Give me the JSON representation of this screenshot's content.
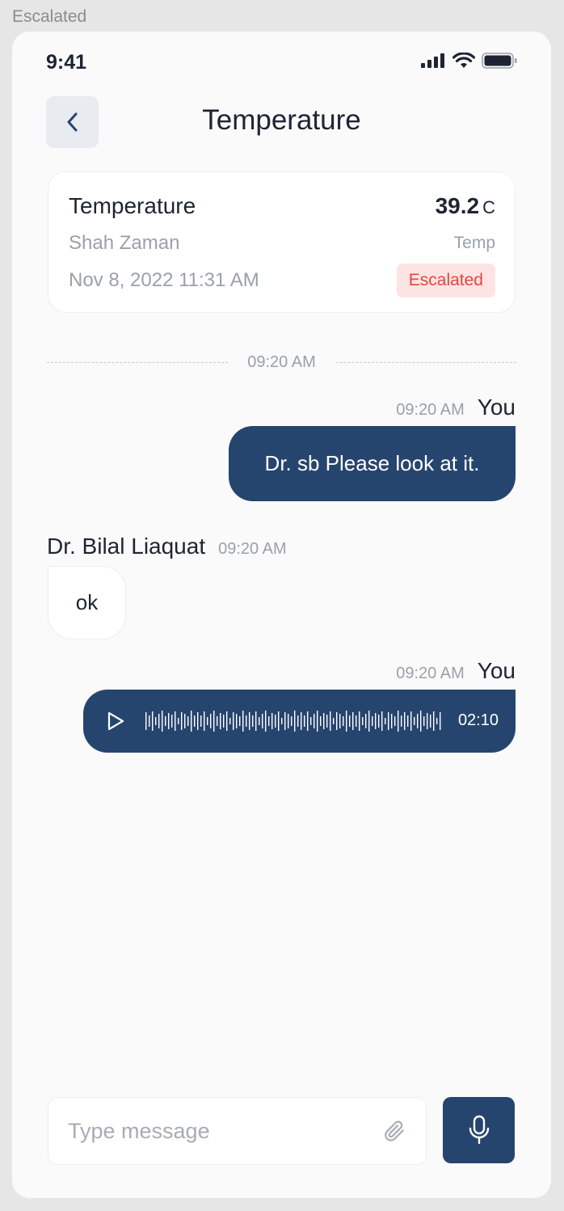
{
  "frame_label": "Escalated",
  "status_bar": {
    "time": "9:41"
  },
  "header": {
    "title": "Temperature"
  },
  "reading": {
    "title": "Temperature",
    "value": "39.2",
    "unit": "C",
    "patient": "Shah Zaman",
    "type": "Temp",
    "date": "Nov 8, 2022 11:31 AM",
    "status": "Escalated"
  },
  "chat": {
    "divider_time": "09:20 AM",
    "messages": [
      {
        "sender": "You",
        "time": "09:20 AM",
        "text": "Dr. sb Please look at it."
      },
      {
        "sender": "Dr. Bilal Liaquat",
        "time": "09:20 AM",
        "text": "ok"
      },
      {
        "sender": "You",
        "time": "09:20 AM",
        "voice_duration": "02:10"
      }
    ]
  },
  "composer": {
    "placeholder": "Type message"
  },
  "colors": {
    "primary": "#26456e",
    "escalated_bg": "#fde4e3",
    "escalated_text": "#e2463f"
  }
}
